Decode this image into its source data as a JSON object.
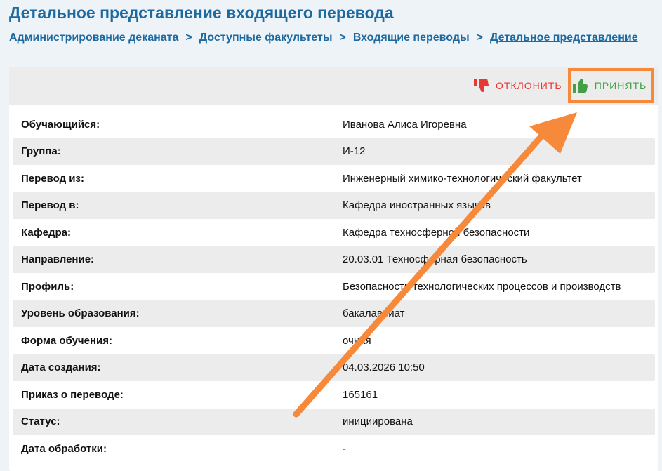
{
  "page": {
    "title": "Детальное представление входящего перевода"
  },
  "breadcrumb": {
    "items": [
      "Администрирование деканата",
      "Доступные факультеты",
      "Входящие переводы",
      "Детальное представление"
    ],
    "separator": ">"
  },
  "toolbar": {
    "reject_label": "ОТКЛОНИТЬ",
    "accept_label": "ПРИНЯТЬ",
    "reject_icon": "thumbs-down-icon",
    "accept_icon": "thumbs-up-icon",
    "reject_color": "#e53935",
    "accept_color": "#43a047",
    "highlight_color": "#f7893b"
  },
  "details": [
    {
      "label": "Обучающийся:",
      "value": "Иванова Алиса Игоревна"
    },
    {
      "label": "Группа:",
      "value": "И-12"
    },
    {
      "label": "Перевод из:",
      "value": "Инженерный химико-технологический факультет"
    },
    {
      "label": "Перевод в:",
      "value": "Кафедра иностранных языков"
    },
    {
      "label": "Кафедра:",
      "value": "Кафедра техносферной безопасности"
    },
    {
      "label": "Направление:",
      "value": "20.03.01 Техносферная безопасность"
    },
    {
      "label": "Профиль:",
      "value": "Безопасность технологических процессов и производств"
    },
    {
      "label": "Уровень образования:",
      "value": "бакалавриат"
    },
    {
      "label": "Форма обучения:",
      "value": "очная"
    },
    {
      "label": "Дата создания:",
      "value": "04.03.2026 10:50"
    },
    {
      "label": "Приказ о переводе:",
      "value": "165161"
    },
    {
      "label": "Статус:",
      "value": "инициирована"
    },
    {
      "label": "Дата обработки:",
      "value": "-"
    }
  ],
  "colors": {
    "title": "#1d6aa0",
    "annotation_arrow": "#f7893b"
  }
}
